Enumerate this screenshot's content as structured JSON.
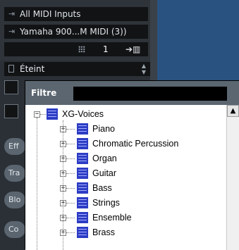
{
  "routing": {
    "input": "All MIDI Inputs",
    "output": "Yamaha 900...M MIDI (3))",
    "channel": "1"
  },
  "program": {
    "value": "Éteint"
  },
  "side_buttons": [
    "Eff",
    "Tra",
    "Blo",
    "Co"
  ],
  "popup": {
    "filter_label": "Filtre",
    "filter_value": "",
    "root": "XG-Voices",
    "items": [
      "Piano",
      "Chromatic Percussion",
      "Organ",
      "Guitar",
      "Bass",
      "Strings",
      "Ensemble",
      "Brass"
    ]
  },
  "colors": {
    "panel_dark": "#2b3036",
    "field_black": "#111315",
    "popup_header": "#5b6670",
    "voice_icon": "#2d3cc4"
  }
}
